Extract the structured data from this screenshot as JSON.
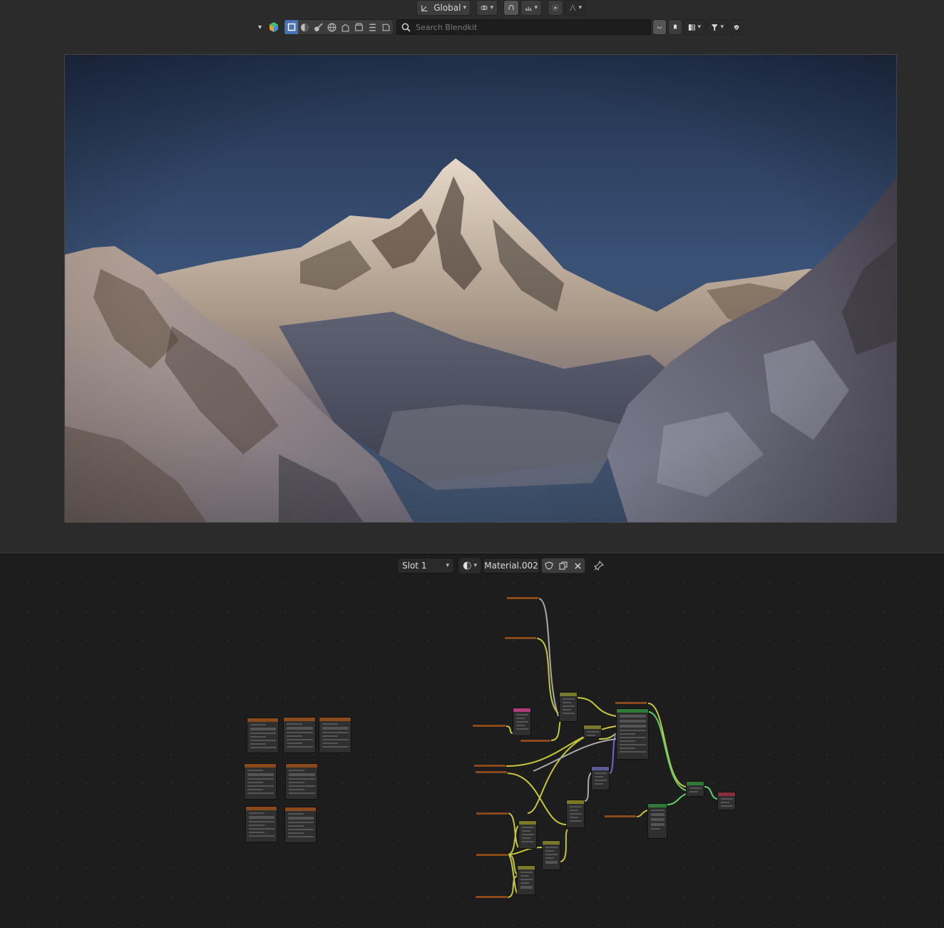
{
  "viewport_header": {
    "orientation_label": "Global",
    "search_placeholder": "Search Blendkit"
  },
  "node_editor_header": {
    "slot_label": "Slot 1",
    "material_name": "Material.002"
  },
  "icons": [
    "transform-orientation-icon",
    "pivot-icon",
    "snap-icon",
    "snap-target-icon",
    "proportional-edit-icon",
    "falloff-icon",
    "object-mode-icon",
    "material-preview-icon",
    "search-icon",
    "bookmark-icon",
    "filter-icon",
    "shield-icon",
    "pin-icon",
    "close-icon",
    "duplicate-icon",
    "fake-user-icon"
  ],
  "colors": {
    "accent": "#4772b3",
    "node_input_header": "#8a4a1c",
    "shader_header": "#2f7a36",
    "vector_header": "#5a5a9a",
    "texture_header": "#7a7a2a",
    "link_yellow": "#c7c63a",
    "link_grey": "#a8a8a8",
    "link_green": "#5fcf6a",
    "link_blue": "#6a6ad0"
  }
}
